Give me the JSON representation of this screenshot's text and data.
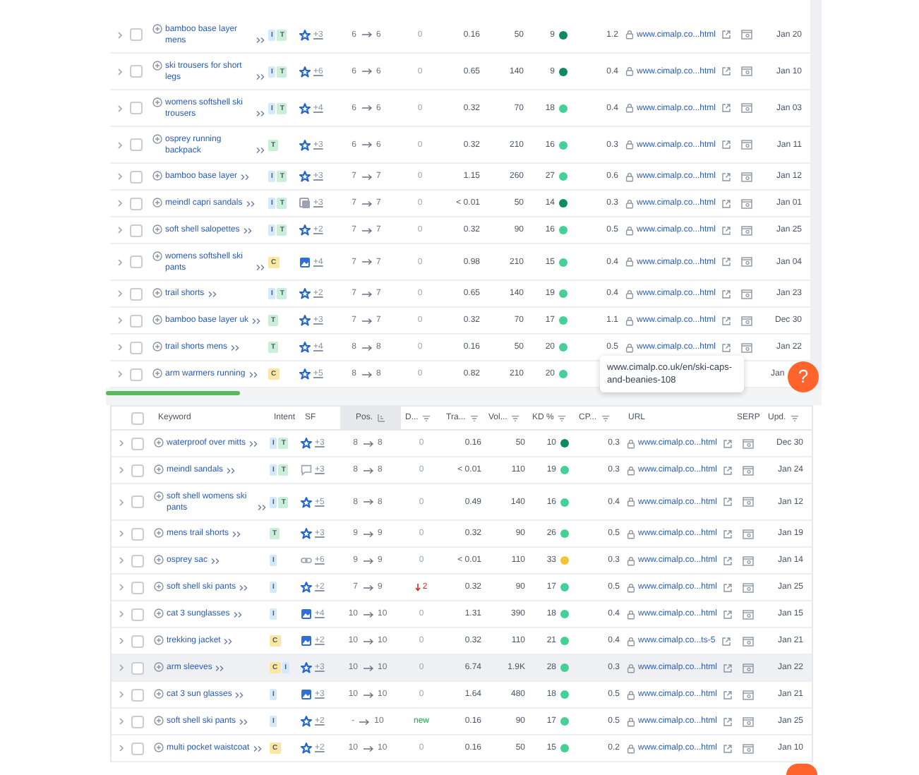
{
  "top_table": {
    "rows": [
      {
        "checked": false,
        "keyword": "bamboo base layer mens",
        "intents": [
          {
            "label": "I",
            "color": "#d4e9fb"
          },
          {
            "label": "T",
            "color": "#c9efd9"
          }
        ],
        "sf": {
          "kind": "star",
          "count": "+3"
        },
        "pos_from": "6",
        "pos_to": "6",
        "diff": {
          "text": "0",
          "kind": "zero"
        },
        "traffic": "0.16",
        "volume": "50",
        "kd": {
          "text": "9",
          "color": "#0e8a5f"
        },
        "cpc": "1.2",
        "url": "www.cimalp.co...html",
        "updated": "Jan 20"
      },
      {
        "checked": false,
        "keyword": "ski trousers for short legs",
        "intents": [
          {
            "label": "I",
            "color": "#d4e9fb"
          },
          {
            "label": "T",
            "color": "#c9efd9"
          }
        ],
        "sf": {
          "kind": "star",
          "count": "+6"
        },
        "pos_from": "6",
        "pos_to": "6",
        "diff": {
          "text": "0",
          "kind": "zero"
        },
        "traffic": "0.65",
        "volume": "140",
        "kd": {
          "text": "9",
          "color": "#0e8a5f"
        },
        "cpc": "0.4",
        "url": "www.cimalp.co...html",
        "updated": "Jan 10"
      },
      {
        "checked": false,
        "keyword": "womens softshell ski trousers",
        "intents": [
          {
            "label": "I",
            "color": "#d4e9fb"
          },
          {
            "label": "T",
            "color": "#c9efd9"
          }
        ],
        "sf": {
          "kind": "star",
          "count": "+4"
        },
        "pos_from": "6",
        "pos_to": "6",
        "diff": {
          "text": "0",
          "kind": "zero"
        },
        "traffic": "0.32",
        "volume": "70",
        "kd": {
          "text": "18",
          "color": "#45d096"
        },
        "cpc": "0.4",
        "url": "www.cimalp.co...html",
        "updated": "Jan 03"
      },
      {
        "checked": false,
        "keyword": "osprey running backpack",
        "intents": [
          {
            "label": "T",
            "color": "#c9efd9"
          }
        ],
        "sf": {
          "kind": "star",
          "count": "+3"
        },
        "pos_from": "6",
        "pos_to": "6",
        "diff": {
          "text": "0",
          "kind": "zero"
        },
        "traffic": "0.32",
        "volume": "210",
        "kd": {
          "text": "16",
          "color": "#45d096"
        },
        "cpc": "0.3",
        "url": "www.cimalp.co...html",
        "updated": "Jan 11"
      },
      {
        "checked": false,
        "keyword": "bamboo base layer",
        "intents": [
          {
            "label": "I",
            "color": "#d4e9fb"
          },
          {
            "label": "T",
            "color": "#c9efd9"
          }
        ],
        "sf": {
          "kind": "star",
          "count": "+3"
        },
        "pos_from": "7",
        "pos_to": "7",
        "diff": {
          "text": "0",
          "kind": "zero"
        },
        "traffic": "1.15",
        "volume": "260",
        "kd": {
          "text": "27",
          "color": "#45d096"
        },
        "cpc": "0.6",
        "url": "www.cimalp.co...html",
        "updated": "Jan 12"
      },
      {
        "checked": false,
        "keyword": "meindl capri sandals",
        "intents": [
          {
            "label": "I",
            "color": "#d4e9fb"
          },
          {
            "label": "T",
            "color": "#c9efd9"
          }
        ],
        "sf": {
          "kind": "gallery",
          "count": "+3"
        },
        "pos_from": "7",
        "pos_to": "7",
        "diff": {
          "text": "0",
          "kind": "zero"
        },
        "traffic": "< 0.01",
        "volume": "50",
        "kd": {
          "text": "14",
          "color": "#0e8a5f"
        },
        "cpc": "0.3",
        "url": "www.cimalp.co...html",
        "updated": "Jan 01"
      },
      {
        "checked": false,
        "keyword": "soft shell salopettes",
        "intents": [
          {
            "label": "I",
            "color": "#d4e9fb"
          },
          {
            "label": "T",
            "color": "#c9efd9"
          }
        ],
        "sf": {
          "kind": "star",
          "count": "+2"
        },
        "pos_from": "7",
        "pos_to": "7",
        "diff": {
          "text": "0",
          "kind": "zero"
        },
        "traffic": "0.32",
        "volume": "90",
        "kd": {
          "text": "16",
          "color": "#45d096"
        },
        "cpc": "0.5",
        "url": "www.cimalp.co...html",
        "updated": "Jan 25"
      },
      {
        "checked": false,
        "keyword": "womens softshell ski pants",
        "intents": [
          {
            "label": "C",
            "color": "#fce7a2"
          }
        ],
        "sf": {
          "kind": "image",
          "count": "+4"
        },
        "pos_from": "7",
        "pos_to": "7",
        "diff": {
          "text": "0",
          "kind": "zero"
        },
        "traffic": "0.98",
        "volume": "210",
        "kd": {
          "text": "15",
          "color": "#45d096"
        },
        "cpc": "0.4",
        "url": "www.cimalp.co...html",
        "updated": "Jan 04"
      },
      {
        "checked": false,
        "keyword": "trail shorts",
        "intents": [
          {
            "label": "I",
            "color": "#d4e9fb"
          },
          {
            "label": "T",
            "color": "#c9efd9"
          }
        ],
        "sf": {
          "kind": "star",
          "count": "+2"
        },
        "pos_from": "7",
        "pos_to": "7",
        "diff": {
          "text": "0",
          "kind": "zero"
        },
        "traffic": "0.65",
        "volume": "140",
        "kd": {
          "text": "19",
          "color": "#45d096"
        },
        "cpc": "0.4",
        "url": "www.cimalp.co...html",
        "updated": "Jan 23"
      },
      {
        "checked": false,
        "keyword": "bamboo base layer uk",
        "intents": [
          {
            "label": "T",
            "color": "#c9efd9"
          }
        ],
        "sf": {
          "kind": "star",
          "count": "+3"
        },
        "pos_from": "7",
        "pos_to": "7",
        "diff": {
          "text": "0",
          "kind": "zero"
        },
        "traffic": "0.32",
        "volume": "70",
        "kd": {
          "text": "17",
          "color": "#45d096"
        },
        "cpc": "1.1",
        "url": "www.cimalp.co...html",
        "updated": "Dec 30"
      },
      {
        "checked": false,
        "keyword": "trail shorts mens",
        "intents": [
          {
            "label": "T",
            "color": "#c9efd9"
          }
        ],
        "sf": {
          "kind": "star",
          "count": "+4"
        },
        "pos_from": "8",
        "pos_to": "8",
        "diff": {
          "text": "0",
          "kind": "zero"
        },
        "traffic": "0.16",
        "volume": "50",
        "kd": {
          "text": "20",
          "color": "#45d096"
        },
        "cpc": "0.5",
        "url": "www.cimalp.co...html",
        "updated": "Jan 22"
      },
      {
        "checked": false,
        "keyword": "arm warmers running",
        "intents": [
          {
            "label": "C",
            "color": "#fce7a2"
          }
        ],
        "sf": {
          "kind": "star",
          "count": "+5"
        },
        "pos_from": "8",
        "pos_to": "8",
        "diff": {
          "text": "0",
          "kind": "zero"
        },
        "traffic": "0.82",
        "volume": "210",
        "kd": {
          "text": "20",
          "color": "#45d096"
        },
        "updated": "Jan"
      }
    ]
  },
  "tooltip": {
    "text": "www.cimalp.co.uk/en/ski-caps-and-beanies-108"
  },
  "help_button": {
    "label": "?"
  },
  "bottom_table": {
    "select_all": {
      "checked": false
    },
    "columns": [
      {
        "label": "Keyword",
        "kind": "plain",
        "selected": false
      },
      {
        "label": "Intent",
        "kind": "plain",
        "selected": false
      },
      {
        "label": "SF",
        "kind": "plain",
        "selected": false
      },
      {
        "label": "Pos.",
        "kind": "sort",
        "selected": true
      },
      {
        "label": "D...",
        "kind": "filter",
        "selected": false
      },
      {
        "label": "Tra...",
        "kind": "filter",
        "selected": false
      },
      {
        "label": "Vol...",
        "kind": "filter",
        "selected": false
      },
      {
        "label": "KD %",
        "kind": "filter",
        "selected": false
      },
      {
        "label": "CP...",
        "kind": "filter",
        "selected": false
      },
      {
        "label": "URL",
        "kind": "plain",
        "selected": false
      },
      {
        "label": "SERP",
        "kind": "plain",
        "selected": false
      },
      {
        "label": "Upd.",
        "kind": "filter",
        "selected": false
      }
    ],
    "rows": [
      {
        "checked": false,
        "highlighted": false,
        "keyword": "waterproof over mitts",
        "intents": [
          {
            "label": "I",
            "color": "#d4e9fb"
          },
          {
            "label": "T",
            "color": "#c9efd9"
          }
        ],
        "sf": {
          "kind": "star",
          "count": "+3"
        },
        "pos_from": "8",
        "pos_to": "8",
        "diff": {
          "text": "0",
          "kind": "zero"
        },
        "traffic": "0.16",
        "volume": "50",
        "kd": {
          "text": "10",
          "color": "#0e8a5f"
        },
        "cpc": "0.3",
        "url": "www.cimalp.co...html",
        "updated": "Dec 30"
      },
      {
        "checked": false,
        "highlighted": false,
        "keyword": "meindl sandals",
        "intents": [
          {
            "label": "I",
            "color": "#d4e9fb"
          },
          {
            "label": "T",
            "color": "#c9efd9"
          }
        ],
        "sf": {
          "kind": "comment",
          "count": "+3"
        },
        "pos_from": "8",
        "pos_to": "8",
        "diff": {
          "text": "0",
          "kind": "zero"
        },
        "traffic": "< 0.01",
        "volume": "110",
        "kd": {
          "text": "19",
          "color": "#45d096"
        },
        "cpc": "0.3",
        "url": "www.cimalp.co...html",
        "updated": "Jan 24"
      },
      {
        "checked": false,
        "highlighted": false,
        "keyword": "soft shell womens ski pants",
        "intents": [
          {
            "label": "I",
            "color": "#d4e9fb"
          },
          {
            "label": "T",
            "color": "#c9efd9"
          }
        ],
        "sf": {
          "kind": "star",
          "count": "+5"
        },
        "pos_from": "8",
        "pos_to": "8",
        "diff": {
          "text": "0",
          "kind": "zero"
        },
        "traffic": "0.49",
        "volume": "140",
        "kd": {
          "text": "16",
          "color": "#45d096"
        },
        "cpc": "0.4",
        "url": "www.cimalp.co...html",
        "updated": "Jan 12"
      },
      {
        "checked": false,
        "highlighted": false,
        "keyword": "mens trail shorts",
        "intents": [
          {
            "label": "T",
            "color": "#c9efd9"
          }
        ],
        "sf": {
          "kind": "star",
          "count": "+3"
        },
        "pos_from": "9",
        "pos_to": "9",
        "diff": {
          "text": "0",
          "kind": "zero"
        },
        "traffic": "0.32",
        "volume": "90",
        "kd": {
          "text": "26",
          "color": "#45d096"
        },
        "cpc": "0.5",
        "url": "www.cimalp.co...html",
        "updated": "Jan 19"
      },
      {
        "checked": false,
        "highlighted": false,
        "keyword": "osprey sac",
        "intents": [
          {
            "label": "I",
            "color": "#d4e9fb"
          }
        ],
        "sf": {
          "kind": "link",
          "count": "+6"
        },
        "pos_from": "9",
        "pos_to": "9",
        "diff": {
          "text": "0",
          "kind": "zero"
        },
        "traffic": "< 0.01",
        "volume": "110",
        "kd": {
          "text": "33",
          "color": "#f2c434"
        },
        "cpc": "0.3",
        "url": "www.cimalp.co...html",
        "updated": "Jan 14"
      },
      {
        "checked": false,
        "highlighted": false,
        "keyword": "soft shell ski pants",
        "intents": [
          {
            "label": "I",
            "color": "#d4e9fb"
          }
        ],
        "sf": {
          "kind": "star",
          "count": "+2"
        },
        "pos_from": "7",
        "pos_to": "9",
        "diff": {
          "text": "2",
          "kind": "down"
        },
        "traffic": "0.32",
        "volume": "90",
        "kd": {
          "text": "17",
          "color": "#45d096"
        },
        "cpc": "0.5",
        "url": "www.cimalp.co...html",
        "updated": "Jan 25"
      },
      {
        "checked": false,
        "highlighted": false,
        "keyword": "cat 3 sunglasses",
        "intents": [
          {
            "label": "I",
            "color": "#d4e9fb"
          }
        ],
        "sf": {
          "kind": "image",
          "count": "+4"
        },
        "pos_from": "10",
        "pos_to": "10",
        "diff": {
          "text": "0",
          "kind": "zero"
        },
        "traffic": "1.31",
        "volume": "390",
        "kd": {
          "text": "18",
          "color": "#45d096"
        },
        "cpc": "0.4",
        "url": "www.cimalp.co...html",
        "updated": "Jan 15"
      },
      {
        "checked": false,
        "highlighted": false,
        "keyword": "trekking jacket",
        "intents": [
          {
            "label": "C",
            "color": "#fce7a2"
          }
        ],
        "sf": {
          "kind": "image",
          "count": "+2"
        },
        "pos_from": "10",
        "pos_to": "10",
        "diff": {
          "text": "0",
          "kind": "zero"
        },
        "traffic": "0.32",
        "volume": "110",
        "kd": {
          "text": "21",
          "color": "#45d096"
        },
        "cpc": "0.4",
        "url": "www.cimalp.co...ts-5",
        "updated": "Jan 21"
      },
      {
        "checked": false,
        "highlighted": true,
        "keyword": "arm sleeves",
        "intents": [
          {
            "label": "C",
            "color": "#fce7a2"
          },
          {
            "label": "I",
            "color": "#d4e9fb"
          }
        ],
        "sf": {
          "kind": "star",
          "count": "+3"
        },
        "pos_from": "10",
        "pos_to": "10",
        "diff": {
          "text": "0",
          "kind": "zero"
        },
        "traffic": "6.74",
        "volume": "1.9K",
        "kd": {
          "text": "28",
          "color": "#45d096"
        },
        "cpc": "0.3",
        "url": "www.cimalp.co...html",
        "updated": "Jan 22"
      },
      {
        "checked": false,
        "highlighted": false,
        "keyword": "cat 3 sun glasses",
        "intents": [
          {
            "label": "I",
            "color": "#d4e9fb"
          }
        ],
        "sf": {
          "kind": "image",
          "count": "+3"
        },
        "pos_from": "10",
        "pos_to": "10",
        "diff": {
          "text": "0",
          "kind": "zero"
        },
        "traffic": "1.64",
        "volume": "480",
        "kd": {
          "text": "18",
          "color": "#45d096"
        },
        "cpc": "0.5",
        "url": "www.cimalp.co...html",
        "updated": "Jan 21"
      },
      {
        "checked": false,
        "highlighted": false,
        "keyword": "soft shell ski pants",
        "intents": [
          {
            "label": "I",
            "color": "#d4e9fb"
          }
        ],
        "sf": {
          "kind": "star",
          "count": "+2"
        },
        "pos_from": "-",
        "pos_to": "10",
        "diff": {
          "text": "new",
          "kind": "new"
        },
        "traffic": "0.16",
        "volume": "90",
        "kd": {
          "text": "17",
          "color": "#45d096"
        },
        "cpc": "0.5",
        "url": "www.cimalp.co...html",
        "updated": "Jan 25"
      },
      {
        "checked": false,
        "highlighted": false,
        "keyword": "multi pocket waistcoat",
        "intents": [
          {
            "label": "C",
            "color": "#fce7a2"
          }
        ],
        "sf": {
          "kind": "star",
          "count": "+2"
        },
        "pos_from": "10",
        "pos_to": "10",
        "diff": {
          "text": "0",
          "kind": "zero"
        },
        "traffic": "0.16",
        "volume": "50",
        "kd": {
          "text": "15",
          "color": "#45d096"
        },
        "cpc": "0.2",
        "url": "www.cimalp.co...html",
        "updated": "Jan 10"
      }
    ]
  }
}
